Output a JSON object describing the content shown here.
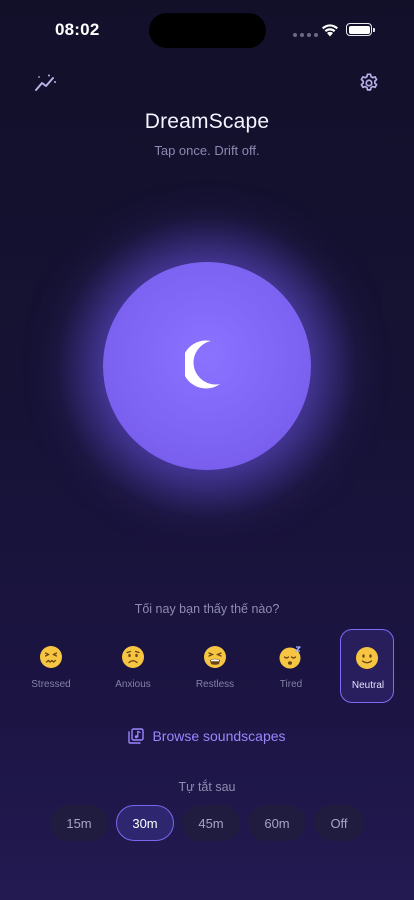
{
  "status_bar": {
    "time": "08:02"
  },
  "header": {
    "title": "DreamScape",
    "tagline": "Tap once. Drift off.",
    "left_icon": "stats-chart-icon",
    "right_icon": "gear-icon"
  },
  "orb": {
    "icon": "moon-icon",
    "color": "#7d63f2"
  },
  "mood": {
    "question": "Tối nay bạn thấy thế nào?",
    "selected": "Neutral",
    "options": [
      {
        "label": "Stressed",
        "icon": "confounded-face-icon"
      },
      {
        "label": "Anxious",
        "icon": "worried-face-icon"
      },
      {
        "label": "Restless",
        "icon": "tired-face-icon"
      },
      {
        "label": "Tired",
        "icon": "sleeping-face-icon"
      },
      {
        "label": "Neutral",
        "icon": "slightly-smiling-face-icon"
      }
    ]
  },
  "browse": {
    "label": "Browse soundscapes",
    "icon": "library-music-icon"
  },
  "timer": {
    "label": "Tự tắt sau",
    "selected": "30m",
    "options": [
      "15m",
      "30m",
      "45m",
      "60m",
      "Off"
    ]
  },
  "colors": {
    "accent": "#7f6bf6",
    "background": "#161235",
    "orb": "#7d63f2"
  }
}
